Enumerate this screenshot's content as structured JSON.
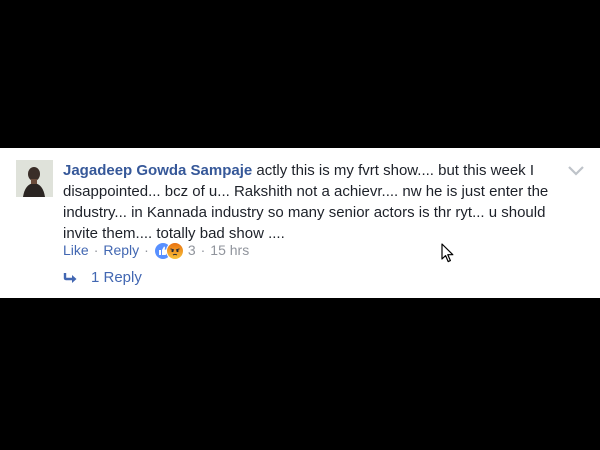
{
  "comment": {
    "author": "Jagadeep Gowda Sampaje",
    "text": " actly this is my fvrt show.... but this week I disappointed... bcz of u... Rakshith not a achievr.... nw he is just enter the industry... in Kannada industry so many senior actors is thr ryt... u should invite them.... totally bad show ....",
    "actions": {
      "like_label": "Like",
      "separator": "·",
      "reply_label": "Reply",
      "reaction_count": "3",
      "timestamp": "15 hrs"
    },
    "replies_label": "1 Reply"
  },
  "icons": {
    "reactions": [
      "like-icon",
      "angry-icon"
    ],
    "menu": "chevron-down-icon",
    "reply_arrow": "reply-arrow-icon",
    "cursor": "mouse-cursor-icon"
  },
  "colors": {
    "author": "#365899",
    "link": "#4267b2",
    "meta": "#90949c",
    "text": "#1d2129",
    "background": "#000000",
    "card": "#ffffff"
  }
}
